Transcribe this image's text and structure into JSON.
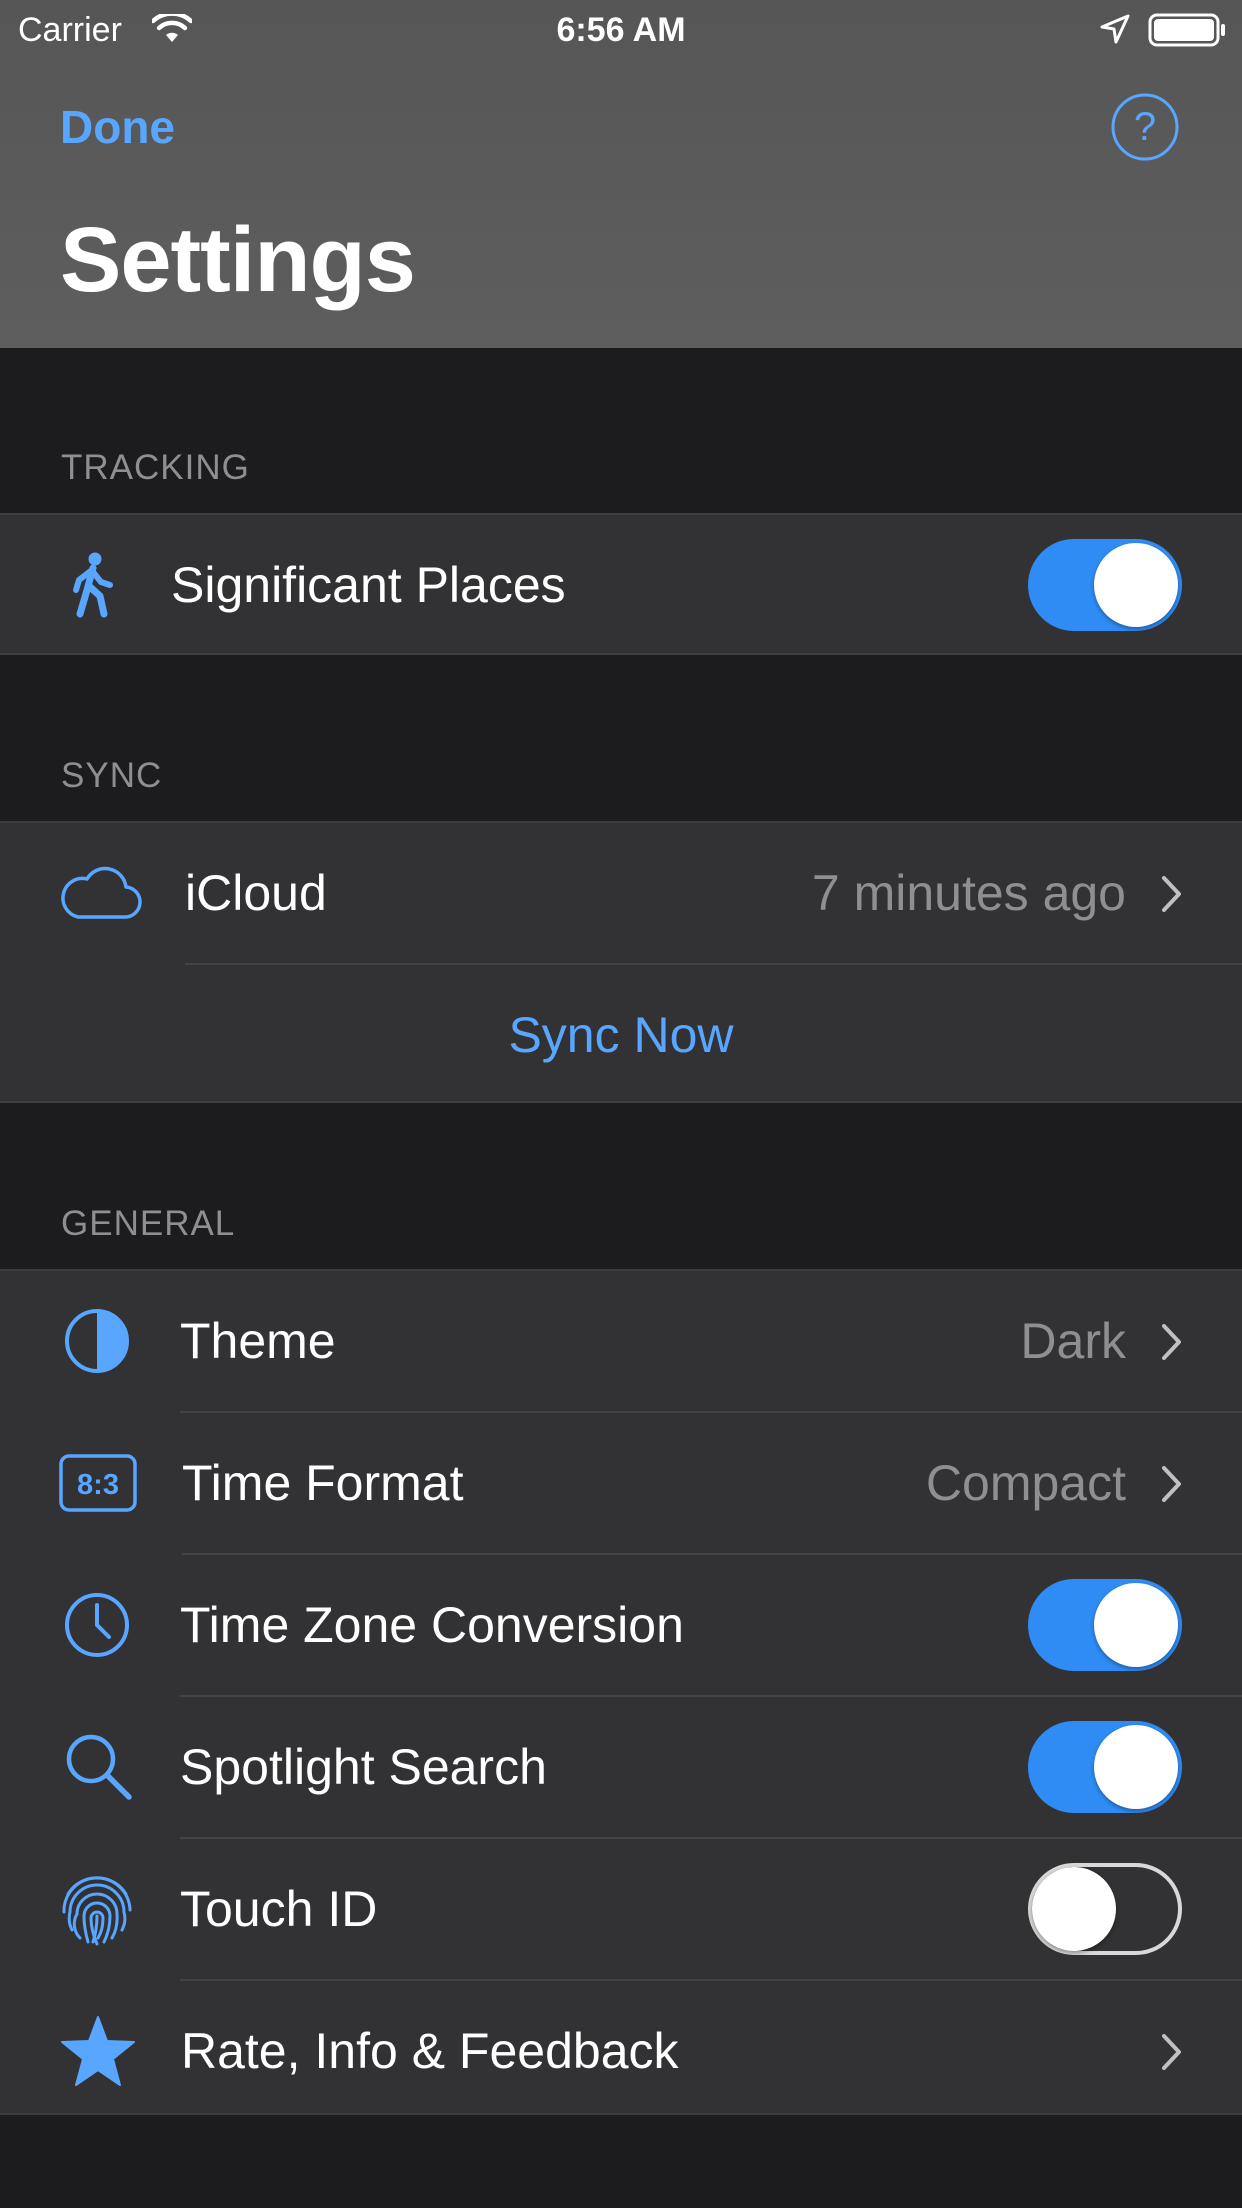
{
  "status_bar": {
    "carrier": "Carrier",
    "time": "6:56 AM"
  },
  "nav": {
    "done_label": "Done",
    "help_glyph": "?",
    "title": "Settings"
  },
  "colors": {
    "accent": "#58a6ff",
    "toggle_on": "#2f8cf5",
    "background": "#1c1c1e",
    "cell": "#323234",
    "header": "#5a5a5a"
  },
  "sections": {
    "tracking": {
      "header": "TRACKING",
      "items": [
        {
          "label": "Significant Places",
          "icon": "walking-person-icon",
          "toggle": true
        }
      ]
    },
    "sync": {
      "header": "SYNC",
      "icloud": {
        "label": "iCloud",
        "icon": "cloud-icon",
        "value": "7 minutes ago"
      },
      "sync_now_label": "Sync Now"
    },
    "general": {
      "header": "GENERAL",
      "items": [
        {
          "label": "Theme",
          "icon": "half-circle-icon",
          "value": "Dark"
        },
        {
          "label": "Time Format",
          "icon": "clock-digits-icon",
          "icon_text": "8:3",
          "value": "Compact"
        },
        {
          "label": "Time Zone Conversion",
          "icon": "clock-icon",
          "toggle": true
        },
        {
          "label": "Spotlight Search",
          "icon": "magnifier-icon",
          "toggle": true
        },
        {
          "label": "Touch ID",
          "icon": "fingerprint-icon",
          "toggle": false
        },
        {
          "label": "Rate, Info & Feedback",
          "icon": "star-icon"
        }
      ]
    }
  }
}
